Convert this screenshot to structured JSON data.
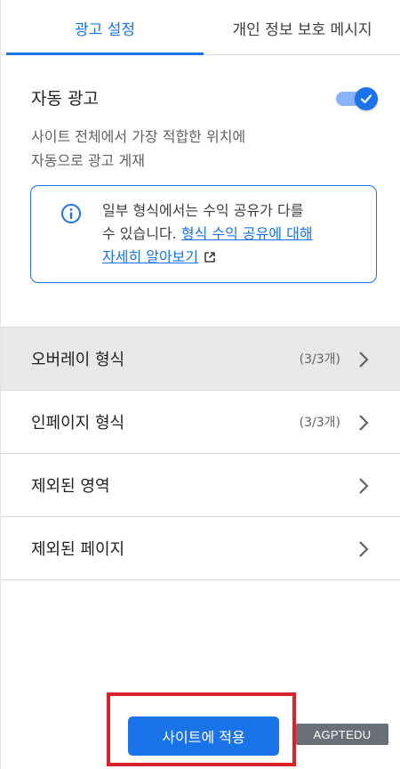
{
  "tabs": [
    {
      "label": "광고 설정",
      "active": true
    },
    {
      "label": "개인 정보 보호 메시지",
      "active": false
    }
  ],
  "auto_ads": {
    "title": "자동 광고",
    "description_line1": "사이트 전체에서 가장 적합한 위치에",
    "description_line2": "자동으로 광고 게재",
    "toggle_on": true
  },
  "info": {
    "text_line1": "일부 형식에서는 수익 공유가 다를",
    "text_line2_prefix": "수 있습니다. ",
    "link_line1": "형식 수익 공유에 대해",
    "link_line2": "자세히 알아보기"
  },
  "list": [
    {
      "label": "오버레이 형식",
      "count": "(3/3개)"
    },
    {
      "label": "인페이지 형식",
      "count": "(3/3개)"
    },
    {
      "label": "제외된 영역",
      "count": ""
    },
    {
      "label": "제외된 페이지",
      "count": ""
    }
  ],
  "apply_button": "사이트에 적용",
  "watermark": "AGPTEDU",
  "colors": {
    "accent": "#1a73e8",
    "highlight_border": "#d9232a",
    "hover_row": "#e8e8e8"
  }
}
